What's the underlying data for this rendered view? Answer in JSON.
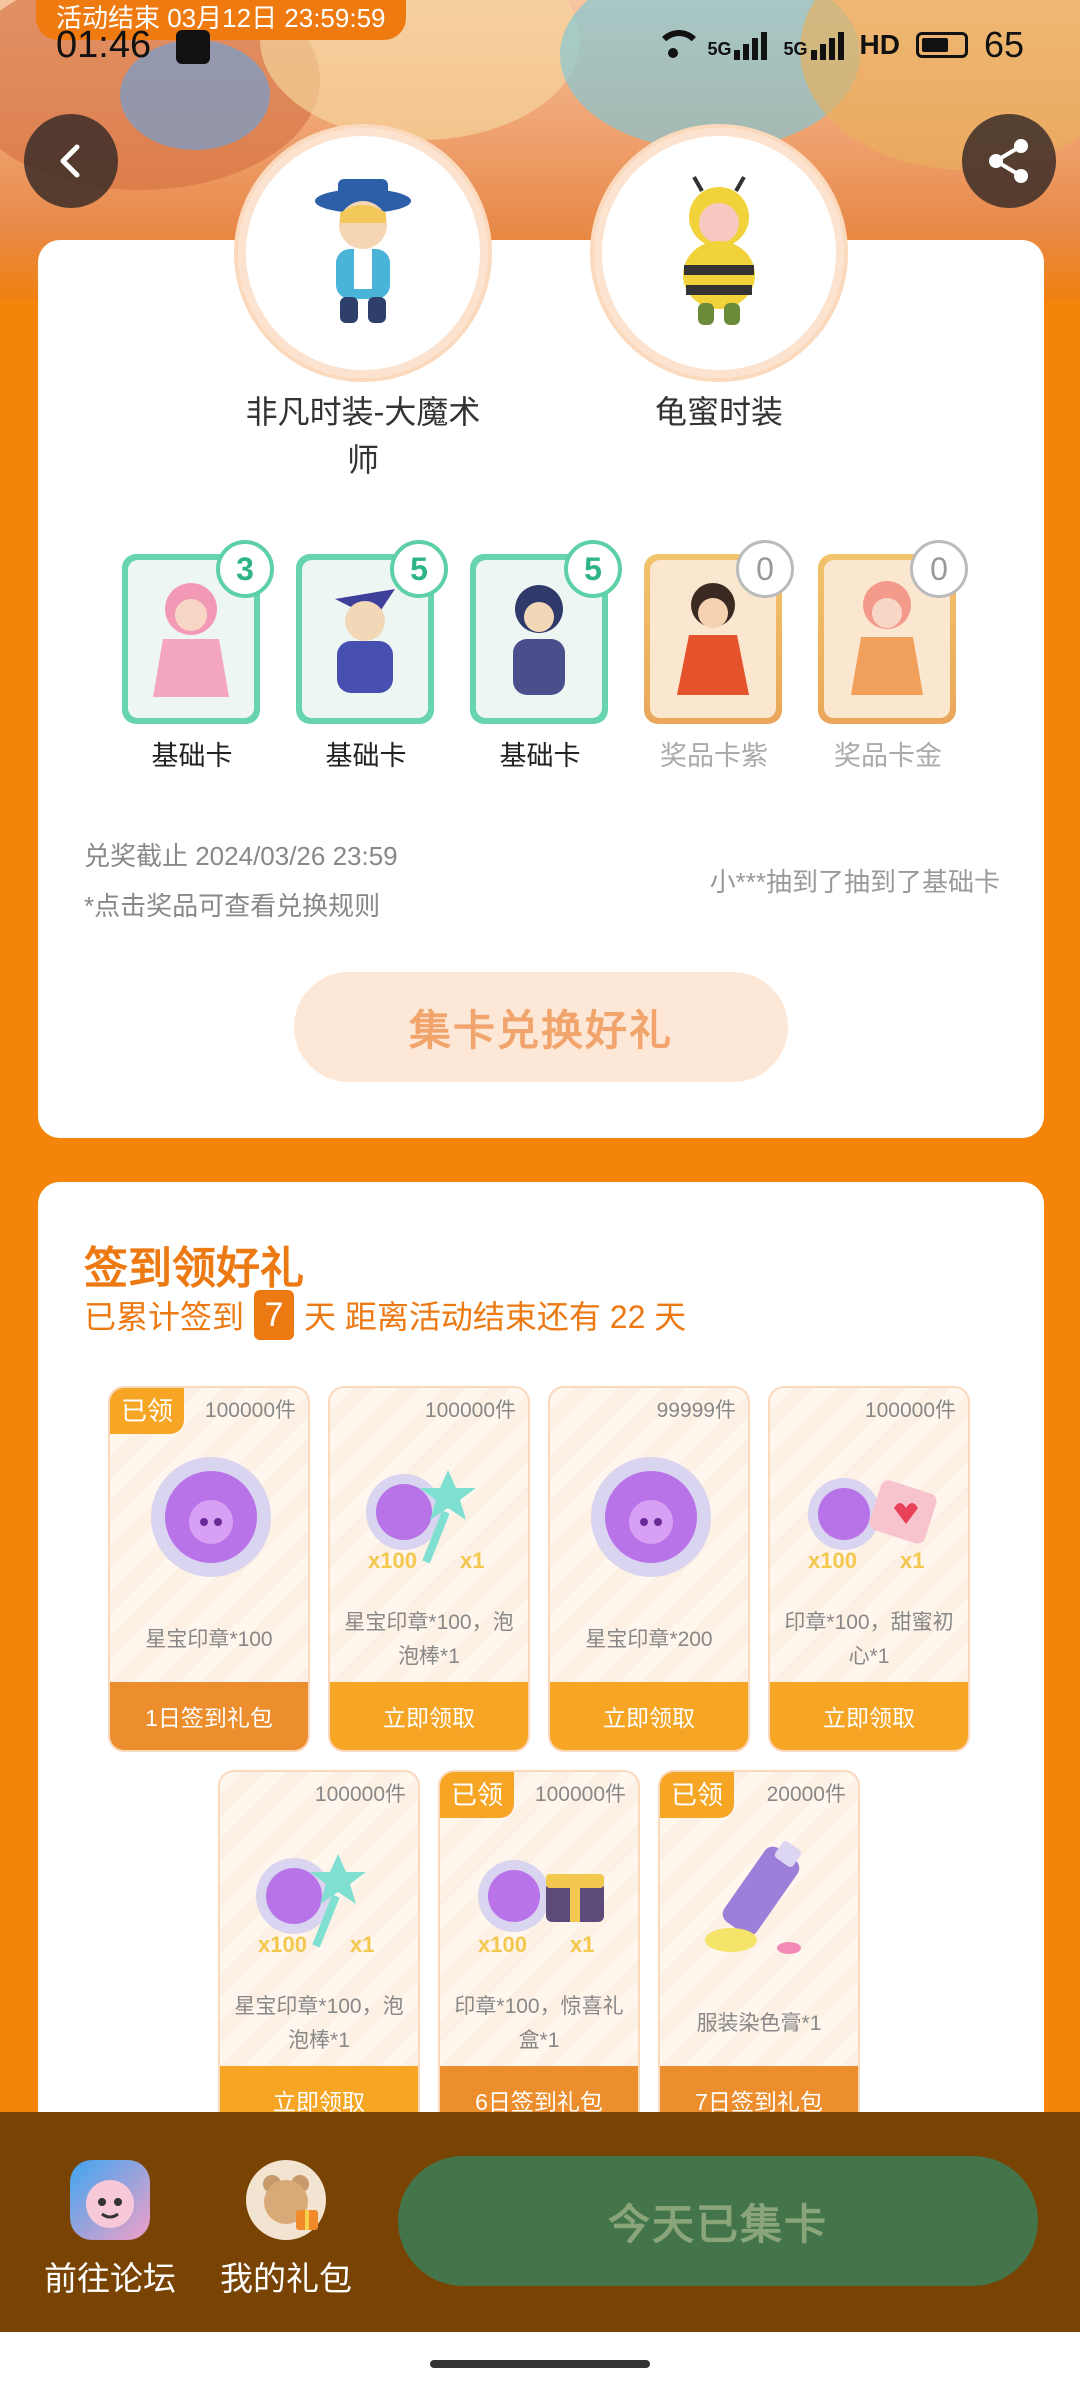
{
  "status_bar": {
    "event_end": "活动结束 03月12日 23:59:59",
    "time": "01:46",
    "network_1": "5G",
    "network_2": "5G",
    "hd": "HD",
    "battery": "65"
  },
  "collection": {
    "costumes": [
      {
        "name": "非凡时装-大魔术师"
      },
      {
        "name": "龟蜜时装"
      }
    ],
    "cards": [
      {
        "label": "基础卡",
        "count": "3",
        "owned": true
      },
      {
        "label": "基础卡",
        "count": "5",
        "owned": true
      },
      {
        "label": "基础卡",
        "count": "5",
        "owned": true
      },
      {
        "label": "奖品卡紫",
        "count": "0",
        "owned": false
      },
      {
        "label": "奖品卡金",
        "count": "0",
        "owned": false
      }
    ],
    "deadline": "兑奖截止 2024/03/26 23:59",
    "rules_hint": "*点击奖品可查看兑换规则",
    "ticker": "小***抽到了抽到了基础卡",
    "exchange_button": "集卡兑换好礼"
  },
  "signin": {
    "title": "签到领好礼",
    "sub_prefix": "已累计签到",
    "days": "7",
    "sub_mid": "天  距离活动结束还有 22 天",
    "got_tag": "已领",
    "gifts": [
      {
        "stock": "100000件",
        "desc": "星宝印章*100",
        "action": "1日签到礼包",
        "claimed": true
      },
      {
        "stock": "100000件",
        "desc": "星宝印章*100，泡泡棒*1",
        "action": "立即领取",
        "claimed": false,
        "qty_a": "x100",
        "qty_b": "x1"
      },
      {
        "stock": "99999件",
        "desc": "星宝印章*200",
        "action": "立即领取",
        "claimed": false
      },
      {
        "stock": "100000件",
        "desc": "印章*100，甜蜜初心*1",
        "action": "立即领取",
        "claimed": false,
        "qty_a": "x100",
        "qty_b": "x1"
      },
      {
        "stock": "100000件",
        "desc": "星宝印章*100，泡泡棒*1",
        "action": "立即领取",
        "claimed": false,
        "qty_a": "x100",
        "qty_b": "x1"
      },
      {
        "stock": "100000件",
        "desc": "印章*100，惊喜礼盒*1",
        "action": "6日签到礼包",
        "claimed": true,
        "qty_a": "x100",
        "qty_b": "x1"
      },
      {
        "stock": "20000件",
        "desc": "服装染色膏*1",
        "action": "7日签到礼包",
        "claimed": true
      }
    ]
  },
  "bottom_bar": {
    "forum": "前往论坛",
    "my_gifts": "我的礼包",
    "today_button": "今天已集卡"
  },
  "colors": {
    "page_orange": "#f5840a",
    "accent_orange": "#ed7912",
    "card_green": "#67d3b0",
    "bottom_brown": "#784303",
    "today_green": "#44744a"
  }
}
